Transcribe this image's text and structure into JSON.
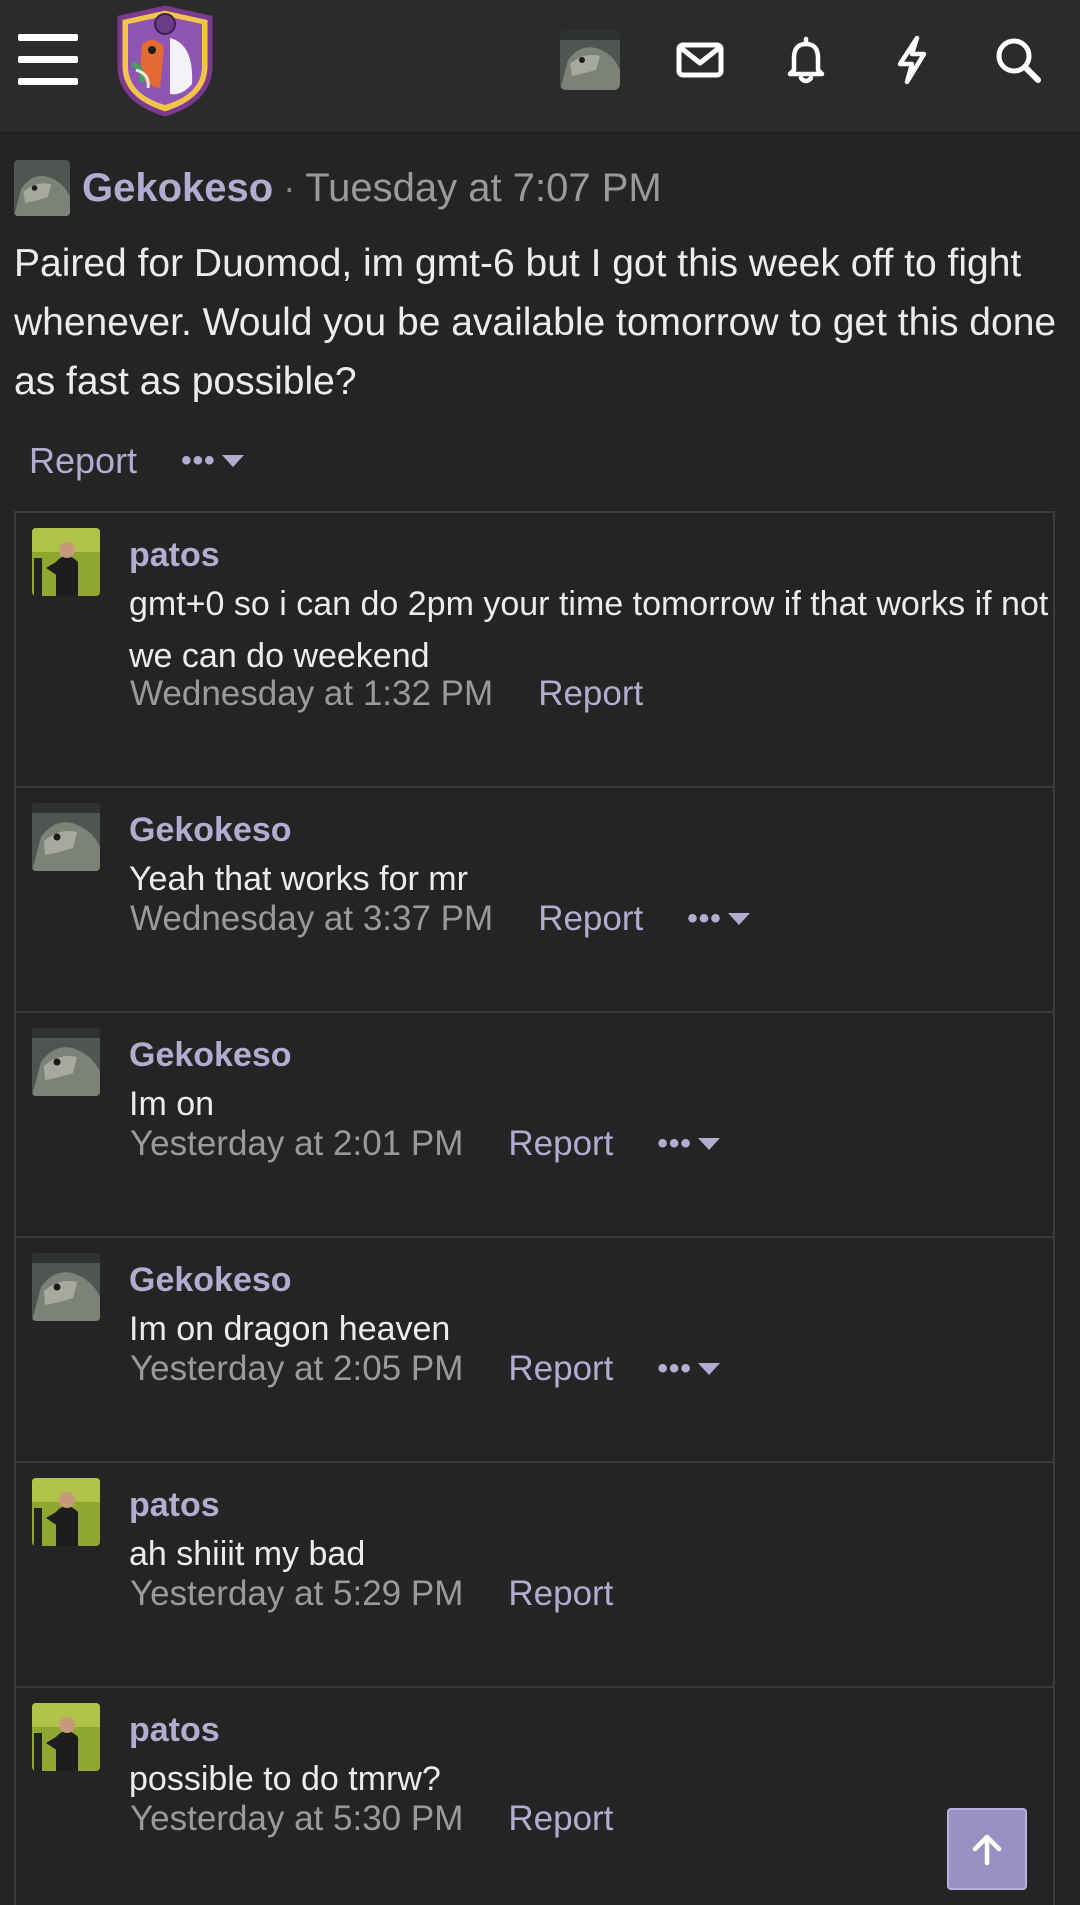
{
  "header": {
    "menu_icon": "hamburger-icon",
    "logo": "site-logo",
    "icons": [
      "avatar",
      "envelope-icon",
      "bell-icon",
      "bolt-icon",
      "search-icon"
    ]
  },
  "post": {
    "author": "Gekokeso",
    "separator": "·",
    "time": "Tuesday at 7:07 PM",
    "body": "Paired for Duomod, im gmt-6 but I got this week off to fight whenever. Would you be available tomorrow to get this done as fast as possible?",
    "report_label": "Report",
    "more_label": "•••"
  },
  "comments": [
    {
      "author": "patos",
      "text": "gmt+0 so i can do 2pm your time tomorrow if that works if not we can do weekend",
      "time": "Wednesday at 1:32 PM",
      "report": "Report",
      "has_more": false,
      "avatar": "patos"
    },
    {
      "author": "Gekokeso",
      "text": "Yeah that works for mr",
      "time": "Wednesday at 3:37 PM",
      "report": "Report",
      "has_more": true,
      "avatar": "gekokeso"
    },
    {
      "author": "Gekokeso",
      "text": "Im on",
      "time": "Yesterday at 2:01 PM",
      "report": "Report",
      "has_more": true,
      "avatar": "gekokeso"
    },
    {
      "author": "Gekokeso",
      "text": "Im on dragon heaven",
      "time": "Yesterday at 2:05 PM",
      "report": "Report",
      "has_more": true,
      "avatar": "gekokeso"
    },
    {
      "author": "patos",
      "text": "ah shiiit my bad",
      "time": "Yesterday at 5:29 PM",
      "report": "Report",
      "has_more": false,
      "avatar": "patos"
    },
    {
      "author": "patos",
      "text": "possible to do tmrw?",
      "time": "Yesterday at 5:30 PM",
      "report": "Report",
      "has_more": false,
      "avatar": "patos"
    }
  ],
  "more_label": "•••",
  "scroll_top_icon": "arrow-up-icon",
  "colors": {
    "accent": "#b3acd0",
    "background": "#242424",
    "header": "#2b2b2b"
  }
}
